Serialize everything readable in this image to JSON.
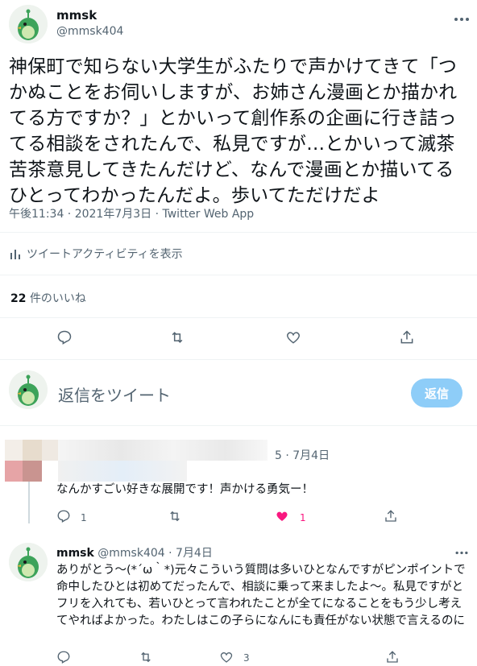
{
  "main_tweet": {
    "display_name": "mmsk",
    "handle": "@mmsk404",
    "text": "神保町で知らない大学生がふたりで声かけてきて「つかぬことをお伺いしますが、お姉さん漫画とか描かれてる方ですか？」とかいって創作系の企画に行き詰ってる相談をされたんで、私見ですが…とかいって滅茶苦茶意見してきたんだけど、なんで漫画とか描いてるひとってわかったんだよ。歩いてただけだよ",
    "timestamp": "午後11:34 · 2021年7月3日 · Twitter Web App",
    "activity_label": "ツイートアクティビティを表示",
    "likes_count": "22",
    "likes_label": "件のいいね"
  },
  "compose": {
    "placeholder": "返信をツイート",
    "button_label": "返信"
  },
  "reply1": {
    "date": "5 · 7月4日",
    "text": "なんかすごい好きな展開です！声かける勇気ー！",
    "reply_count": "1",
    "like_count": "1",
    "liked": true,
    "like_color": "#f91880"
  },
  "reply2": {
    "display_name": "mmsk",
    "handle_date": "@mmsk404 · 7月4日",
    "text": "ありがとう～(*´ω｀*)元々こういう質問は多いひとなんですがピンポイントで命中したひとは初めてだったんで、相談に乗って来ましたよ～。私見ですがとフリを入れても、若いひとって言われたことが全てになることをもう少し考えてやればよかった。わたしはこの子らになんにも責任がない状態で言えるのに",
    "like_count": "3"
  },
  "icons": [
    "more-icon",
    "bar-chart-icon",
    "reply-icon",
    "retweet-icon",
    "like-icon",
    "share-icon"
  ],
  "colors": {
    "accent": "#1d9bf0",
    "reply_button_disabled": "#8ecdf8",
    "like": "#f91880"
  }
}
